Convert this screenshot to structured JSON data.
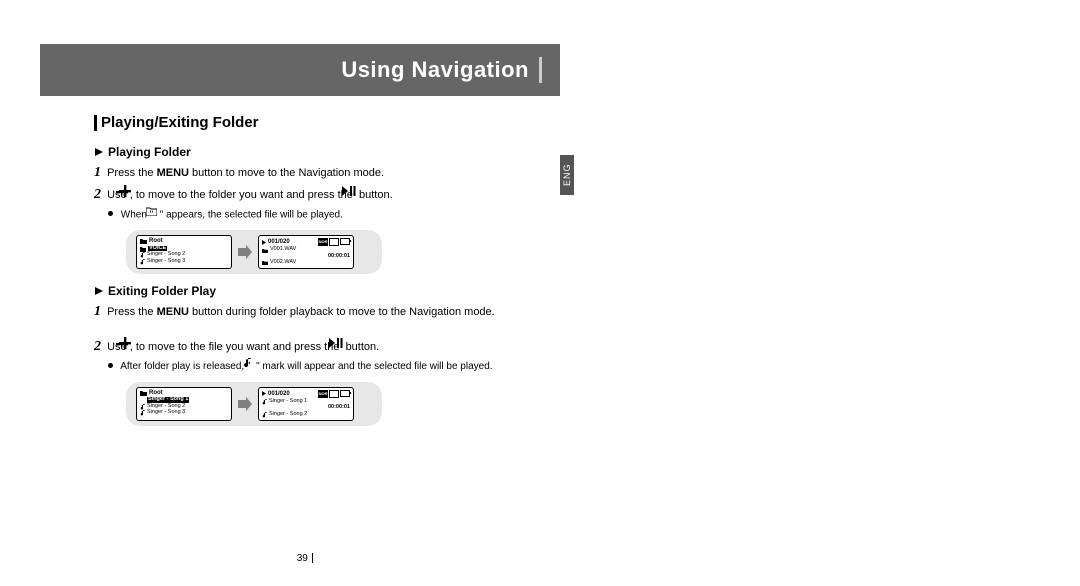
{
  "header": {
    "title": "Using Navigation"
  },
  "language_tab": "ENG",
  "page_number": "39",
  "section": {
    "title": "Playing/Exiting Folder",
    "playing": {
      "heading": "Playing Folder",
      "step1_a": "Press the ",
      "step1_menu": "MENU",
      "step1_b": " button to move to the Navigation mode.",
      "step2_a": "Use ",
      "step2_b": " to move to the folder you want and press the ",
      "step2_c": " button.",
      "note_a": "When \" ",
      "note_b": " \" appears, the selected file will be played.",
      "diagram": {
        "left": {
          "header": "Root",
          "selected": "VOICE",
          "line2": "Singer - Song 2",
          "line3": "Singer - Song 3"
        },
        "right": {
          "counter": "001/020",
          "file": "V001.WAV",
          "time": "00:00:01",
          "file2": "V002.WAV"
        }
      }
    },
    "exiting": {
      "heading": "Exiting Folder Play",
      "step1_a": "Press the ",
      "step1_menu": "MENU",
      "step1_b": " button during folder playback to move to the Navigation mode.",
      "step2_a": "Use ",
      "step2_b": " to move to the file you want and press the ",
      "step2_c": " button.",
      "note_a": "After folder play is released, \" ",
      "note_b": " \" mark will appear and the selected file will be played.",
      "diagram": {
        "left": {
          "header": "Root",
          "selected": "Singer - Song 1",
          "line2": "Singer - Song 2",
          "line3": "Singer - Song 3"
        },
        "right": {
          "counter": "001/020",
          "file": "Singer - Song 1",
          "time": "00:00:01",
          "file2": "Singer - Song 2"
        }
      }
    }
  }
}
